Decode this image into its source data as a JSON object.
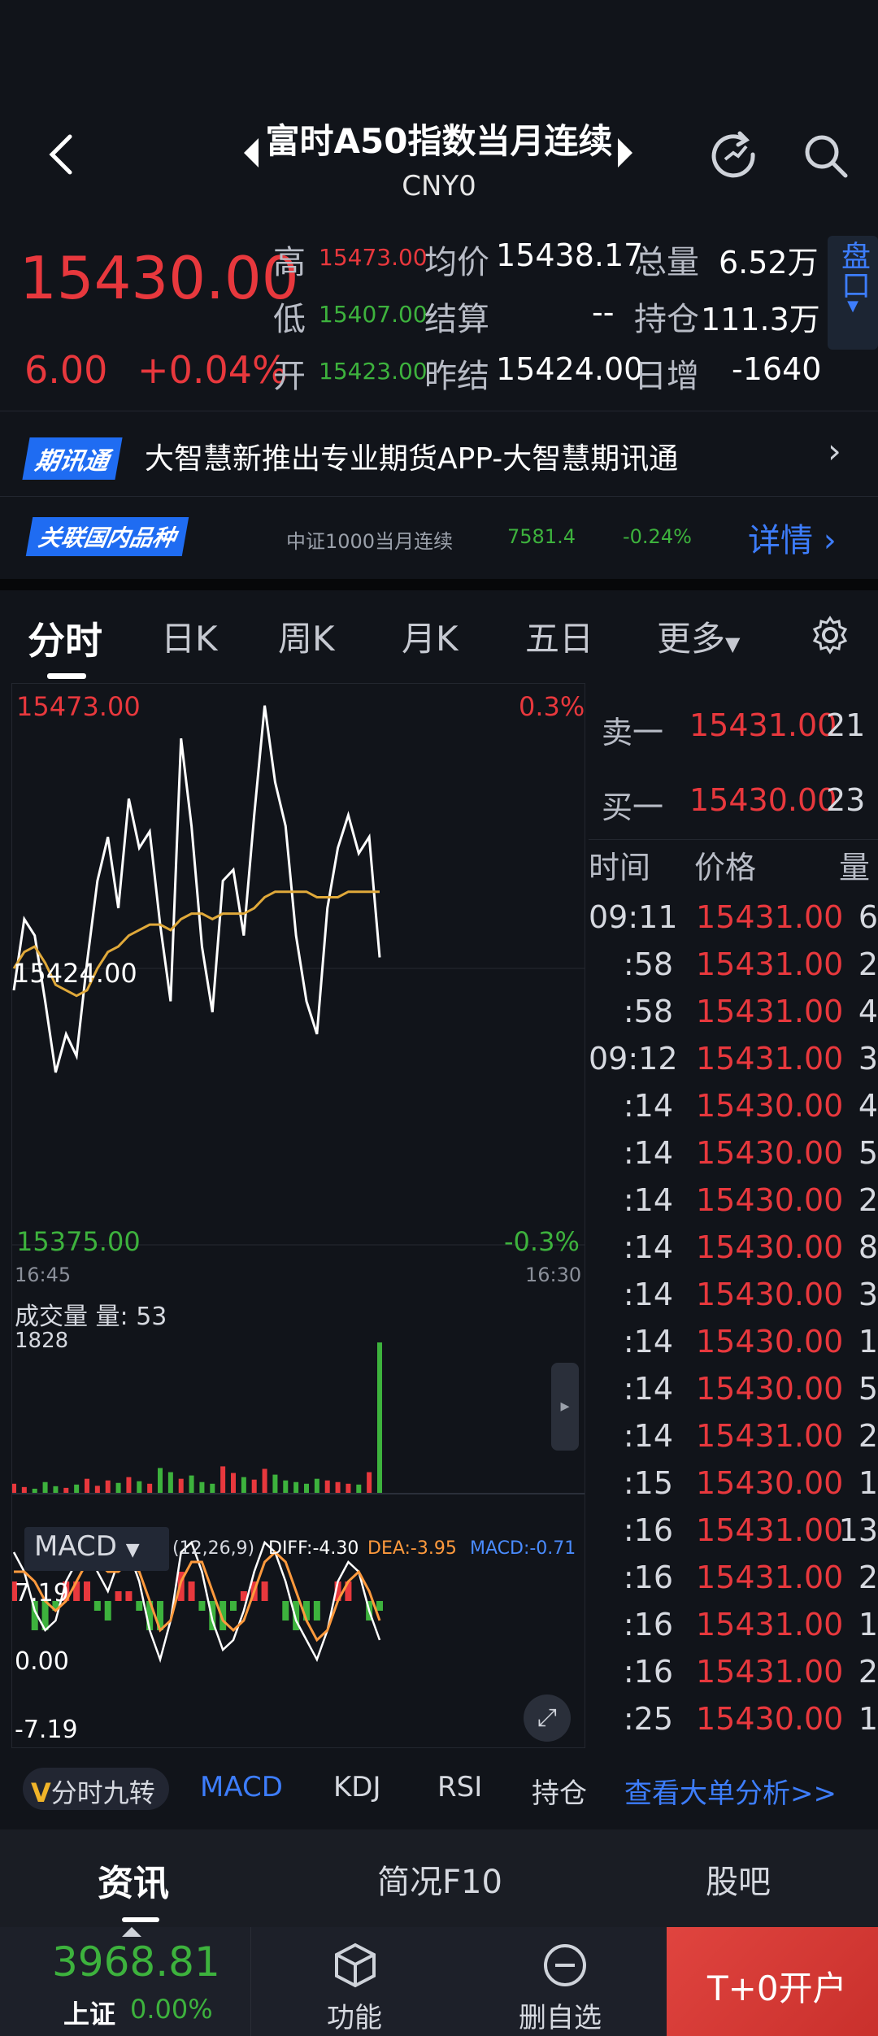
{
  "header": {
    "title": "富时A50指数当月连续",
    "code": "CNY0"
  },
  "quote": {
    "price": "15430.00",
    "change": "6.00",
    "change_pct": "+0.04%",
    "high_label": "高",
    "high": "15473.00",
    "low_label": "低",
    "low": "15407.00",
    "open_label": "开",
    "open": "15423.00",
    "avg_label": "均价",
    "avg": "15438.17",
    "settle_label": "结算",
    "settle": "--",
    "prev_settle_label": "昨结",
    "prev_settle": "15424.00",
    "vol_label": "总量",
    "vol": "6.52万",
    "oi_label": "持仓",
    "oi": "111.3万",
    "daily_inc_label": "日增",
    "daily_inc": "-1640",
    "pankou": "盘口"
  },
  "news": {
    "tag": "期讯通",
    "text": "大智慧新推出专业期货APP-大智慧期讯通"
  },
  "related": {
    "tag": "关联国内品种",
    "name": "中证1000当月连续",
    "price": "7581.4",
    "pct": "-0.24%",
    "detail": "详情"
  },
  "tabs": [
    "分时",
    "日K",
    "周K",
    "月K",
    "五日",
    "更多"
  ],
  "chart": {
    "top_price": "15473.00",
    "top_pct": "0.3%",
    "mid_price": "15424.00",
    "bottom_price": "15375.00",
    "bottom_pct": "-0.3%",
    "time_start": "16:45",
    "time_end": "16:30",
    "vol_label": "成交量",
    "vol_amount_label": "量: 53",
    "vol_max": "1828",
    "macd_label": "MACD",
    "macd_params": "(12,26,9)",
    "diff": "DIFF:-4.30",
    "dea": "DEA:-3.95",
    "macd_val": "MACD:-0.71",
    "macd_top": "7.19",
    "macd_mid": "0.00",
    "macd_bottom": "-7.19",
    "colors": {
      "up": "#e8383d",
      "down": "#3db23d",
      "price_line": "#ffffff",
      "avg_line": "#e0a93a",
      "dea": "#ff9a3d",
      "macd": "#4a8cff"
    }
  },
  "chart_data": {
    "type": "line",
    "title": "",
    "ylim": [
      15375,
      15473
    ],
    "series": [
      {
        "values": [
          15420,
          15433,
          15430,
          15418,
          15405,
          15412,
          15408,
          15425,
          15440,
          15448,
          15435,
          15455,
          15446,
          15449,
          15432,
          15418,
          15466,
          15450,
          15428,
          15416,
          15440,
          15442,
          15430,
          15452,
          15472,
          15458,
          15450,
          15430,
          15418,
          15412,
          15435,
          15446,
          15452,
          15445,
          15448,
          15426
        ]
      },
      {
        "values": [
          15424,
          15427,
          15428,
          15425,
          15421,
          15420,
          15419,
          15420,
          15424,
          15427,
          15428,
          15430,
          15431,
          15432,
          15432,
          15431,
          15433,
          15434,
          15434,
          15433,
          15434,
          15434,
          15434,
          15435,
          15437,
          15438,
          15438,
          15438,
          15438,
          15437,
          15437,
          15437,
          15438,
          15438,
          15438,
          15438
        ]
      }
    ],
    "volume": [
      120,
      80,
      60,
      140,
      90,
      70,
      110,
      180,
      95,
      160,
      130,
      200,
      150,
      120,
      310,
      260,
      180,
      220,
      140,
      120,
      330,
      250,
      200,
      170,
      300,
      230,
      160,
      140,
      120,
      180,
      160,
      140,
      120,
      110,
      260,
      1828
    ],
    "macd": {
      "diff": [
        5,
        3,
        -1,
        -3,
        -2,
        2,
        4,
        6,
        3,
        1,
        4,
        5,
        2,
        -3,
        -6,
        -2,
        5,
        6,
        3,
        -2,
        -5,
        -4,
        -1,
        3,
        6,
        5,
        2,
        -2,
        -4,
        -6,
        -3,
        2,
        4,
        3,
        -1,
        -4
      ],
      "dea": [
        3,
        3,
        2,
        0,
        -1,
        0,
        2,
        4,
        4,
        3,
        3,
        4,
        3,
        0,
        -3,
        -2,
        2,
        4,
        4,
        1,
        -2,
        -3,
        -2,
        1,
        4,
        5,
        4,
        1,
        -2,
        -4,
        -3,
        0,
        2,
        3,
        1,
        -2
      ],
      "hist": [
        2,
        0,
        -3,
        -3,
        -1,
        2,
        2,
        2,
        -1,
        -2,
        1,
        1,
        -1,
        -3,
        -3,
        0,
        3,
        2,
        -1,
        -3,
        -3,
        -1,
        1,
        2,
        2,
        0,
        -2,
        -3,
        -2,
        -2,
        0,
        2,
        2,
        0,
        -2,
        -1
      ]
    }
  },
  "depth": {
    "sell_label": "卖一",
    "sell_price": "15431.00",
    "sell_qty": "21",
    "buy_label": "买一",
    "buy_price": "15430.00",
    "buy_qty": "23",
    "head_time": "时间",
    "head_price": "价格",
    "head_qty": "量"
  },
  "ticks": [
    {
      "t": "09:11",
      "p": "15431.00",
      "q": "6"
    },
    {
      "t": ":58",
      "p": "15431.00",
      "q": "2"
    },
    {
      "t": ":58",
      "p": "15431.00",
      "q": "4"
    },
    {
      "t": "09:12",
      "p": "15431.00",
      "q": "3"
    },
    {
      "t": ":14",
      "p": "15430.00",
      "q": "4"
    },
    {
      "t": ":14",
      "p": "15430.00",
      "q": "5"
    },
    {
      "t": ":14",
      "p": "15430.00",
      "q": "2"
    },
    {
      "t": ":14",
      "p": "15430.00",
      "q": "8"
    },
    {
      "t": ":14",
      "p": "15430.00",
      "q": "3"
    },
    {
      "t": ":14",
      "p": "15430.00",
      "q": "1"
    },
    {
      "t": ":14",
      "p": "15430.00",
      "q": "5"
    },
    {
      "t": ":14",
      "p": "15431.00",
      "q": "2"
    },
    {
      "t": ":15",
      "p": "15430.00",
      "q": "1"
    },
    {
      "t": ":16",
      "p": "15431.00",
      "q": "13"
    },
    {
      "t": ":16",
      "p": "15431.00",
      "q": "2"
    },
    {
      "t": ":16",
      "p": "15431.00",
      "q": "1"
    },
    {
      "t": ":16",
      "p": "15431.00",
      "q": "2"
    },
    {
      "t": ":25",
      "p": "15430.00",
      "q": "1"
    }
  ],
  "indicators": {
    "v_label": "分时九转",
    "items": [
      "MACD",
      "KDJ",
      "RSI",
      "持仓"
    ],
    "link": "查看大单分析>>"
  },
  "bottom_tabs": [
    "资讯",
    "简况F10",
    "股吧"
  ],
  "footer": {
    "index_value": "3968.81",
    "index_name": "上证",
    "index_pct": "0.00%",
    "func": "功能",
    "del": "删自选",
    "open": "T+0开户"
  }
}
